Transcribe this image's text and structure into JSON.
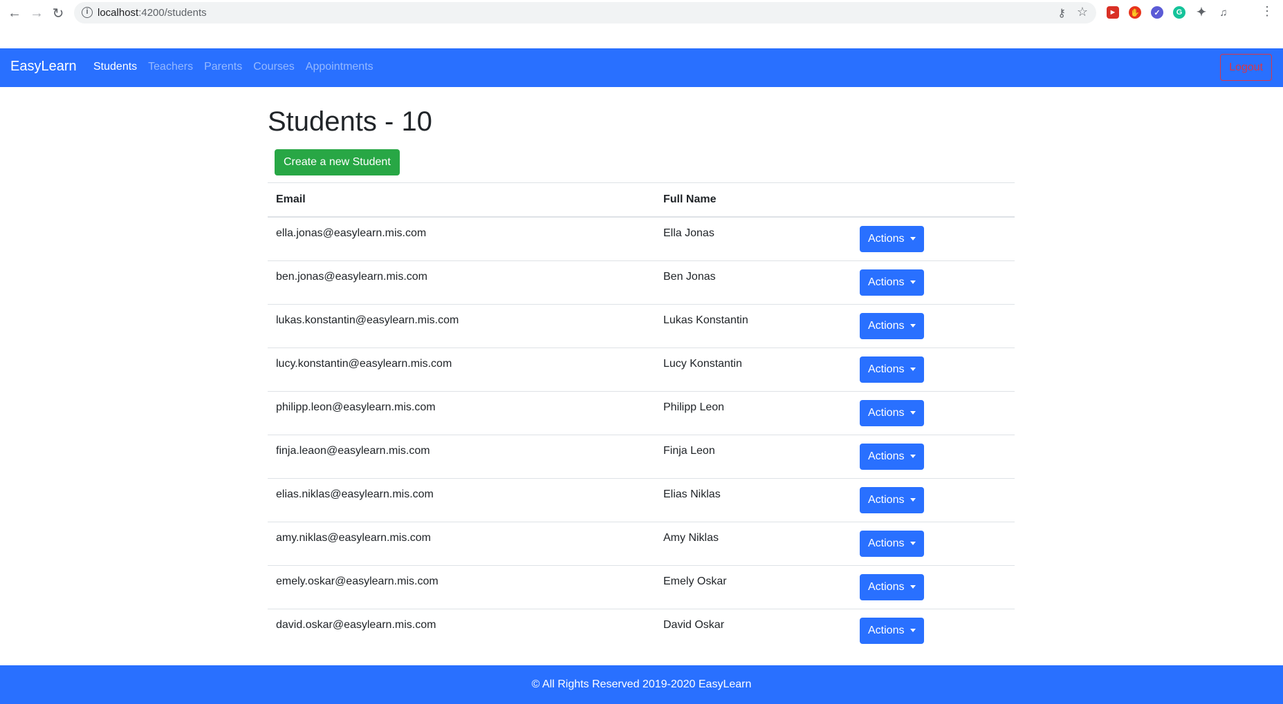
{
  "browser": {
    "url_host": "localhost",
    "url_path": ":4200/students"
  },
  "navbar": {
    "brand": "EasyLearn",
    "links": [
      "Students",
      "Teachers",
      "Parents",
      "Courses",
      "Appointments"
    ],
    "active": "Students",
    "logout_label": "Logout"
  },
  "main": {
    "title": "Students - 10",
    "create_label": "Create a new Student",
    "columns": [
      "Email",
      "Full Name"
    ],
    "actions_label": "Actions",
    "rows": [
      {
        "email": "ella.jonas@easylearn.mis.com",
        "name": "Ella Jonas"
      },
      {
        "email": "ben.jonas@easylearn.mis.com",
        "name": "Ben Jonas"
      },
      {
        "email": "lukas.konstantin@easylearn.mis.com",
        "name": "Lukas Konstantin"
      },
      {
        "email": "lucy.konstantin@easylearn.mis.com",
        "name": "Lucy Konstantin"
      },
      {
        "email": "philipp.leon@easylearn.mis.com",
        "name": "Philipp Leon"
      },
      {
        "email": "finja.leaon@easylearn.mis.com",
        "name": "Finja Leon"
      },
      {
        "email": "elias.niklas@easylearn.mis.com",
        "name": "Elias Niklas"
      },
      {
        "email": "amy.niklas@easylearn.mis.com",
        "name": "Amy Niklas"
      },
      {
        "email": "emely.oskar@easylearn.mis.com",
        "name": "Emely Oskar"
      },
      {
        "email": "david.oskar@easylearn.mis.com",
        "name": "David Oskar"
      }
    ]
  },
  "footer": {
    "text": "© All Rights Reserved 2019-2020 EasyLearn"
  },
  "colors": {
    "primary": "#2970ff",
    "success": "#28a745",
    "danger": "#dc3545"
  }
}
